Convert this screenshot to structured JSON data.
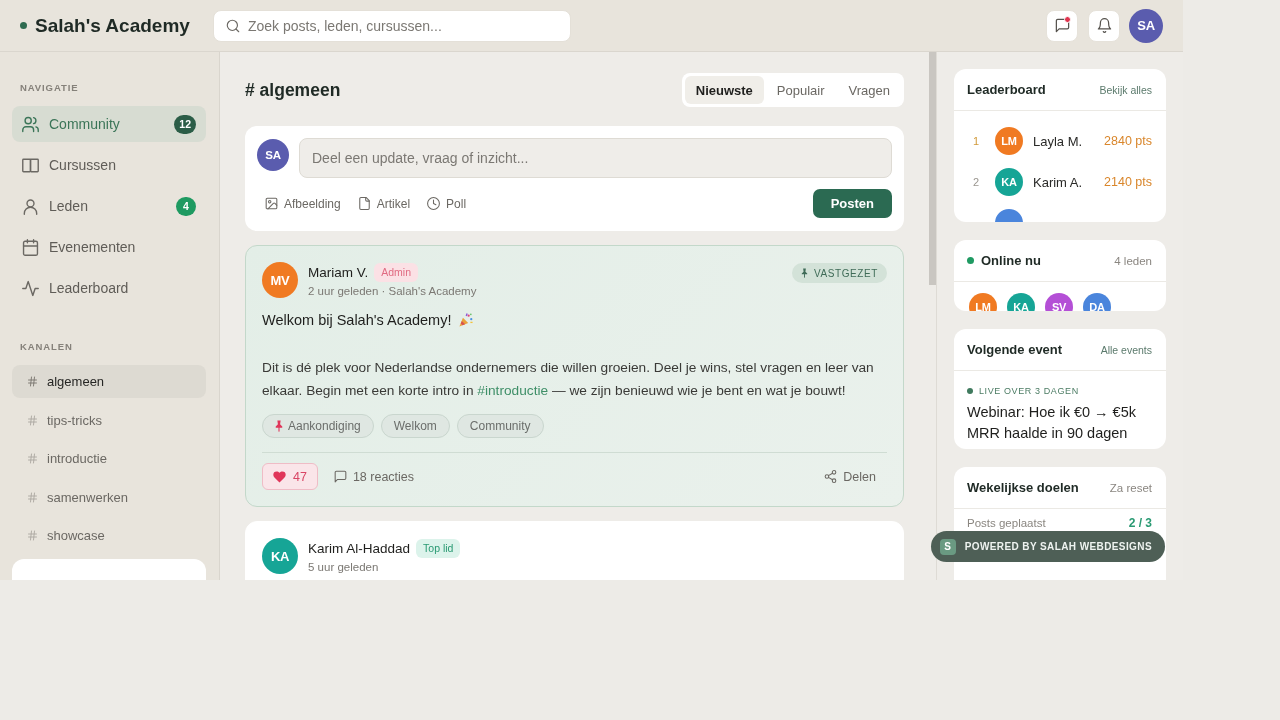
{
  "header": {
    "brand": "Salah's Academy",
    "search": {
      "placeholder": "Zoek posts, leden, cursussen..."
    },
    "actions": [
      {
        "kind": "messages",
        "unread": true
      },
      {
        "kind": "notifications",
        "unread": false
      }
    ],
    "user": {
      "initials": "SA",
      "color": "#5a5cae"
    }
  },
  "sidebar": {
    "sections": [
      {
        "kind": "nav",
        "title": "NAVIGATIE",
        "items": [
          {
            "label": "Community",
            "badge": "12",
            "selected": true
          },
          {
            "label": "Cursussen",
            "selected": false
          },
          {
            "label": "Leden",
            "badge": "4",
            "selected": false
          },
          {
            "label": "Evenementen",
            "selected": false
          },
          {
            "label": "Leaderboard",
            "selected": false
          }
        ]
      },
      {
        "kind": "channels",
        "title": "KANALEN",
        "items": [
          {
            "label": "algemeen",
            "selected": true
          },
          {
            "label": "tips-tricks",
            "selected": false
          },
          {
            "label": "introductie",
            "selected": false
          },
          {
            "label": "samenwerken",
            "selected": false
          },
          {
            "label": "showcase",
            "selected": false
          }
        ]
      }
    ]
  },
  "feed": {
    "channel_title": "# algemeen",
    "tabs": [
      {
        "label": "Nieuwste",
        "selected": true
      },
      {
        "label": "Populair",
        "selected": false
      },
      {
        "label": "Vragen",
        "selected": false
      }
    ],
    "composer": {
      "avatar": {
        "initials": "SA",
        "color": "#5a5cae"
      },
      "placeholder": "Deel een update, vraag of inzicht...",
      "attachments": [
        {
          "label": "Afbeelding"
        },
        {
          "label": "Artikel"
        },
        {
          "label": "Poll"
        }
      ],
      "submit": "Posten"
    },
    "posts": [
      {
        "author": "Mariam V.",
        "avatar": {
          "initials": "MV",
          "color": "#f07a22"
        },
        "role": {
          "label": "Admin",
          "kind": "admin"
        },
        "meta": "2 uur geleden · Salah's Academy",
        "pinned": true,
        "pinned_label": "VASTGEZET",
        "title": "Welkom bij Salah's Academy!",
        "body": [
          {
            "kind": "text",
            "text": "Dit is dé plek voor Nederlandse ondernemers die willen groeien. Deel je wins, stel vragen en leer van elkaar. Begin met een korte intro in "
          },
          {
            "kind": "link",
            "text": "#introductie"
          },
          {
            "kind": "text",
            "text": " — we zijn benieuwd wie je bent en wat je bouwt!"
          }
        ],
        "tags": [
          {
            "label": "Aankondiging",
            "kind": "announcement"
          },
          {
            "label": "Welkom",
            "kind": "topic"
          },
          {
            "label": "Community",
            "kind": "topic"
          }
        ],
        "likes": {
          "count": "47",
          "liked": true
        },
        "comments": "18 reacties",
        "share": "Delen"
      },
      {
        "author": "Karim Al-Haddad",
        "avatar": {
          "initials": "KA",
          "color": "#16a596"
        },
        "role": {
          "label": "Top lid",
          "kind": "top"
        },
        "meta": "5 uur geleden",
        "pinned": false
      }
    ]
  },
  "widgets": {
    "leaderboard": {
      "title": "Leaderboard",
      "link": "Bekijk alles",
      "rows": [
        {
          "rank": "1",
          "avatar": {
            "initials": "LM",
            "color": "#f07a22"
          },
          "name": "Layla M.",
          "points": "2840 pts"
        },
        {
          "rank": "2",
          "avatar": {
            "initials": "KA",
            "color": "#16a596"
          },
          "name": "Karim A.",
          "points": "2140 pts"
        },
        {
          "avatar": {
            "color": "#4a85dc"
          }
        }
      ]
    },
    "online": {
      "title": "Online nu",
      "count": "4 leden",
      "members": [
        {
          "initials": "LM",
          "color": "#f07a22"
        },
        {
          "initials": "KA",
          "color": "#16a596"
        },
        {
          "initials": "SV",
          "color": "#b44fd6"
        },
        {
          "initials": "DA",
          "color": "#4a85dc"
        }
      ]
    },
    "event": {
      "title": "Volgende event",
      "link": "Alle events",
      "status": "LIVE OVER 3 DAGEN",
      "name": "Webinar: Hoe ik €0 → €5k MRR haalde in 90 dagen"
    },
    "goals": {
      "title": "Wekelijkse doelen",
      "note": "Za reset",
      "items": [
        {
          "label": "Posts geplaatst",
          "value": "2 / 3"
        }
      ]
    }
  },
  "powered_badge": {
    "logo": "S",
    "label": "POWERED BY SALAH WEBDESIGNS"
  }
}
